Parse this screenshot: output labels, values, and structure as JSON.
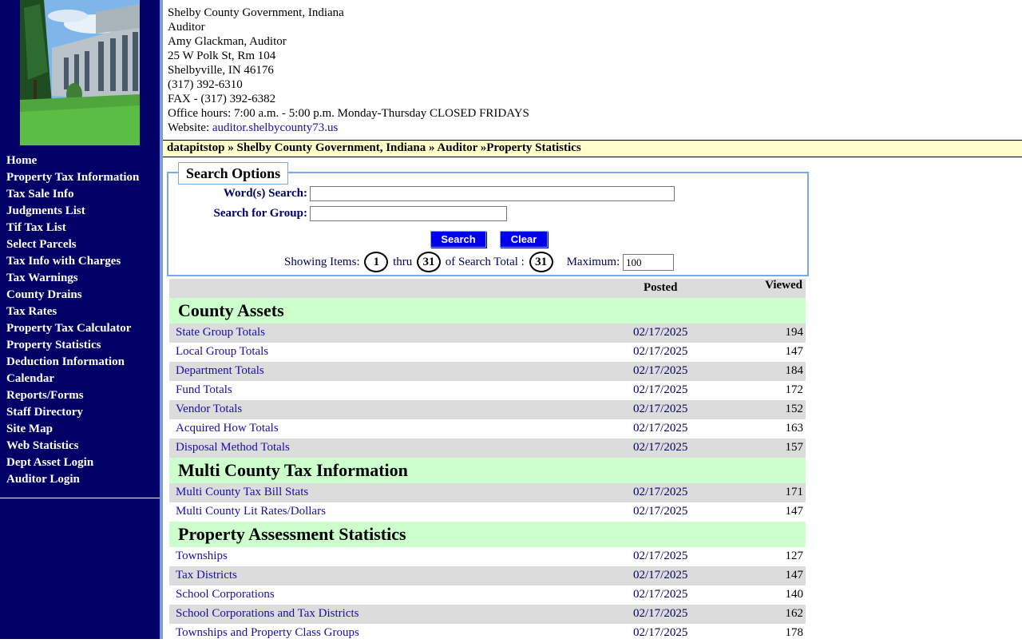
{
  "header": {
    "lines": [
      "Shelby County Government, Indiana",
      "Auditor",
      "Amy Glackman, Auditor",
      "25 W Polk St, Rm 104",
      "Shelbyville, IN 46176",
      "(317) 392-6310",
      "FAX - (317) 392-6382",
      "Office hours: 7:00 a.m. - 5:00 p.m. Monday-Thursday CLOSED FRIDAYS"
    ],
    "website_label": "Website:",
    "website_link": "auditor.shelbycounty73.us"
  },
  "breadcrumb": "datapitstop » Shelby County Government, Indiana » Auditor »Property Statistics",
  "nav": [
    "Home",
    "Property Tax Information",
    "Tax Sale Info",
    "Judgments List",
    "Tif Tax List",
    "Select Parcels",
    "Tax Info with Charges",
    "Tax Warnings",
    "County Drains",
    "Tax Rates",
    "Property Tax Calculator",
    "Property Statistics",
    "Deduction Information",
    "Calendar",
    "Reports/Forms",
    "Staff Directory",
    "Site Map",
    "Web Statistics",
    "Dept Asset Login",
    "Auditor Login"
  ],
  "search": {
    "legend": "Search Options",
    "words_label": "Word(s) Search:",
    "words_value": "",
    "group_label": "Search for Group:",
    "group_value": "",
    "search_button": "Search",
    "clear_button": "Clear",
    "showing_label": "Showing Items:",
    "from": "1",
    "thru_label": "thru",
    "to": "31",
    "total_label": "of Search Total :",
    "total": "31",
    "max_label": "Maximum:",
    "max_value": "100"
  },
  "table": {
    "posted_header": "Posted",
    "viewed_header": "Viewed",
    "groups": [
      {
        "title": "County Assets",
        "rows": [
          {
            "name": "State Group Totals",
            "date": "02/17/2025",
            "views": "194"
          },
          {
            "name": "Local Group Totals",
            "date": "02/17/2025",
            "views": "147"
          },
          {
            "name": "Department Totals",
            "date": "02/17/2025",
            "views": "184"
          },
          {
            "name": "Fund Totals",
            "date": "02/17/2025",
            "views": "172"
          },
          {
            "name": "Vendor Totals",
            "date": "02/17/2025",
            "views": "152"
          },
          {
            "name": "Acquired How Totals",
            "date": "02/17/2025",
            "views": "163"
          },
          {
            "name": "Disposal Method Totals",
            "date": "02/17/2025",
            "views": "157"
          }
        ]
      },
      {
        "title": "Multi County Tax Information",
        "rows": [
          {
            "name": "Multi County Tax Bill Stats",
            "date": "02/17/2025",
            "views": "171"
          },
          {
            "name": "Multi County Lit Rates/Dollars",
            "date": "02/17/2025",
            "views": "147"
          }
        ]
      },
      {
        "title": "Property Assessment Statistics",
        "rows": [
          {
            "name": "Townships",
            "date": "02/17/2025",
            "views": "127"
          },
          {
            "name": "Tax Districts",
            "date": "02/17/2025",
            "views": "147"
          },
          {
            "name": "School Corporations",
            "date": "02/17/2025",
            "views": "140"
          },
          {
            "name": "School Corporations and Tax Districts",
            "date": "02/17/2025",
            "views": "162"
          },
          {
            "name": "Townships and Property Class Groups",
            "date": "02/17/2025",
            "views": "178"
          }
        ]
      }
    ]
  }
}
